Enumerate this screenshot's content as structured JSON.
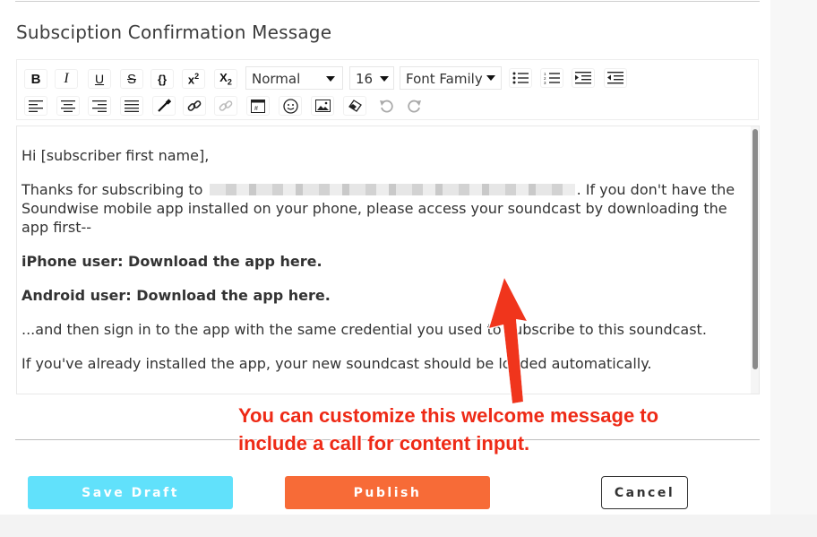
{
  "section": {
    "title": "Subsciption Confirmation Message"
  },
  "toolbar": {
    "row1": [
      {
        "name": "bold-icon",
        "glyph": "B"
      },
      {
        "name": "italic-icon",
        "glyph": "I"
      },
      {
        "name": "underline-icon",
        "glyph": "U"
      },
      {
        "name": "strikethrough-icon",
        "glyph": "S"
      },
      {
        "name": "code-icon",
        "glyph": "{}"
      },
      {
        "name": "superscript-icon",
        "glyph": "x²"
      },
      {
        "name": "subscript-icon",
        "glyph": "X₂"
      }
    ],
    "block_format": "Normal",
    "font_size": "16",
    "font_family": "Font Family",
    "icons_row1_right": [
      "unordered-list-icon",
      "ordered-list-icon",
      "indent-icon",
      "outdent-icon"
    ],
    "icons_row2": [
      "align-left-icon",
      "align-center-icon",
      "align-right-icon",
      "align-justify-icon",
      "color-picker-icon",
      "link-icon",
      "unlink-icon",
      "embedded-icon",
      "emoji-icon",
      "image-icon",
      "eraser-icon",
      "undo-icon",
      "redo-icon"
    ]
  },
  "editor": {
    "greeting": "Hi [subscriber first name],",
    "thanks_before": "Thanks for subscribing to",
    "thanks_after": ". If you don't have the Soundwise mobile app installed on your phone, please access your soundcast by downloading the app first--",
    "iphone_line": "iPhone user: Download the app  here.",
    "android_line": "Android user: Download the app  here.",
    "signin_line": "...and then sign in to the app with the same credential you used to subscribe to this soundcast.",
    "installed_line": "If you've already installed the app, your new soundcast should be loaded automatically."
  },
  "annotation": {
    "line1": "You can customize this welcome message to",
    "line2": "include a call for content input.",
    "color": "#ee2a16"
  },
  "buttons": {
    "save_draft": "Save Draft",
    "publish": "Publish",
    "cancel": "Cancel"
  },
  "colors": {
    "save_draft_bg": "#61e1fb",
    "publish_bg": "#f76b37"
  }
}
